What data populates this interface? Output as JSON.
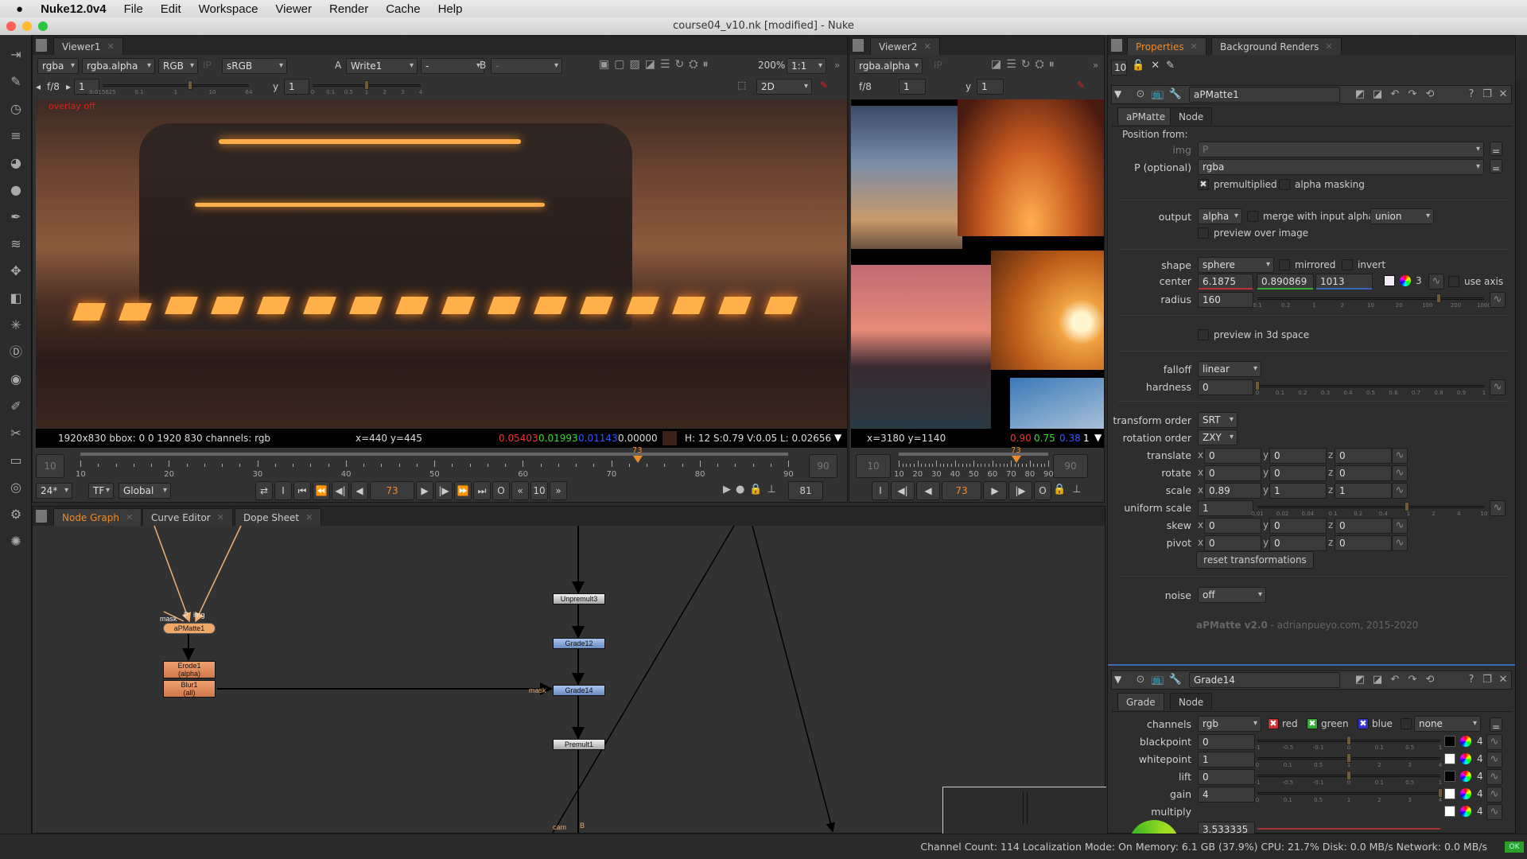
{
  "menubar": {
    "app": "Nuke12.0v4",
    "items": [
      "File",
      "Edit",
      "Workspace",
      "Viewer",
      "Render",
      "Cache",
      "Help"
    ]
  },
  "window": {
    "title": "course04_v10.nk [modified] - Nuke"
  },
  "colors": {
    "accent": "#f08a28",
    "node_orange": "#e8926a",
    "node_blue": "#7a9ccc",
    "node_grey": "#c8c8c8",
    "pixel_swatch": "#3a2218"
  },
  "viewer1": {
    "tab": "Viewer1",
    "toolbar": {
      "channels": "rgba",
      "layer": "rgba.alpha",
      "display": "RGB",
      "ip": "IP",
      "lut": "sRGB",
      "a_label": "A",
      "a_input": "Write1",
      "wipe": "-",
      "b_label": "B",
      "b_input": "-",
      "zoom": "200%",
      "ratio": "1:1"
    },
    "row2": {
      "fstop": "f/8",
      "gain": "1",
      "gain_ticks": [
        "0.015625",
        "0.1",
        "1",
        "10",
        "64"
      ],
      "gamma_label": "y",
      "gamma": "1",
      "gamma_ticks": [
        "0",
        "0.1",
        "0.5",
        "1",
        "2",
        "3",
        "4"
      ],
      "mode": "2D"
    },
    "overlay": "overlay off",
    "info": {
      "format": "1920x830  bbox: 0 0 1920 830 channels: rgb",
      "coords": "x=440 y=445",
      "r": "0.05403",
      "g": "0.01993",
      "b": "0.01143",
      "a": "0.00000",
      "hsvl": "H: 12 S:0.79 V:0.05  L: 0.02656"
    },
    "timeline": {
      "start": "10",
      "end": "90",
      "ticks": [
        "10",
        "20",
        "30",
        "40",
        "50",
        "60",
        "70",
        "80",
        "90"
      ],
      "current": "73",
      "range": [
        10,
        90
      ]
    },
    "controls": {
      "fps": "24*",
      "tf": "TF",
      "scope": "Global",
      "in": "I",
      "out": "O",
      "frame": "73",
      "step": "10",
      "end_frame": "81"
    }
  },
  "viewer2": {
    "tab": "Viewer2",
    "toolbar": {
      "layer": "rgba.alpha",
      "ip": "IP"
    },
    "row2": {
      "fstop": "f/8",
      "gain": "1",
      "gamma_label": "y",
      "gamma": "1"
    },
    "info": {
      "coords": "x=3180 y=1140",
      "r": "0.90",
      "g": "0.75",
      "b": "0.38",
      "a": "1"
    },
    "timeline": {
      "start": "10",
      "end": "90",
      "ticks": [
        "10",
        "20",
        "30",
        "40",
        "50",
        "60",
        "70",
        "80",
        "90"
      ],
      "current": "73"
    },
    "controls": {
      "in": "I",
      "out": "O",
      "frame": "73"
    }
  },
  "nodegraph": {
    "tabs": [
      "Node Graph",
      "Curve Editor",
      "Dope Sheet"
    ],
    "nodes": {
      "apmatte": "aPMatte1",
      "erode": "Erode1\n(alpha)",
      "blur": "Blur1\n(all)",
      "unpremult": "Unpremult3",
      "grade12": "Grade12",
      "grade14": "Grade14",
      "premult": "Premult1"
    },
    "labels": {
      "mask": "mask",
      "p": "P",
      "img": "img",
      "mask2": "mask",
      "cam": "cam",
      "b": "B"
    }
  },
  "properties": {
    "tabs": [
      "Properties",
      "Background Renders"
    ],
    "max_panels": "10",
    "apmatte": {
      "name": "aPMatte1",
      "tabs": [
        "aPMatte",
        "Node"
      ],
      "position_from": "Position from:",
      "img_label": "img",
      "img_value": "P",
      "p_label": "P (optional)",
      "p_value": "rgba",
      "premultiplied": "premultiplied",
      "alpha_masking": "alpha masking",
      "output_label": "output",
      "output_value": "alpha",
      "merge_label": "merge with input alpha",
      "merge_op": "union",
      "preview_over": "preview over image",
      "shape_label": "shape",
      "shape_value": "sphere",
      "mirrored": "mirrored",
      "invert": "invert",
      "center_label": "center",
      "center": [
        "6.1875",
        "0.890869",
        "1013"
      ],
      "center_channels": "3",
      "use_axis": "use axis",
      "radius_label": "radius",
      "radius": "160",
      "radius_ticks": [
        "0.1",
        "0.2",
        "1",
        "2",
        "10",
        "20",
        "100",
        "200",
        "1000"
      ],
      "preview_3d": "preview in 3d space",
      "falloff_label": "falloff",
      "falloff_value": "linear",
      "hardness_label": "hardness",
      "hardness": "0",
      "hardness_ticks": [
        "0",
        "0.1",
        "0.2",
        "0.3",
        "0.4",
        "0.5",
        "0.6",
        "0.7",
        "0.8",
        "0.9",
        "1"
      ],
      "transform_order_label": "transform order",
      "transform_order": "SRT",
      "rotation_order_label": "rotation order",
      "rotation_order": "ZXY",
      "xyz": [
        {
          "label": "translate",
          "x": "0",
          "y": "0",
          "z": "0"
        },
        {
          "label": "rotate",
          "x": "0",
          "y": "0",
          "z": "0"
        },
        {
          "label": "scale",
          "x": "0.89",
          "y": "1",
          "z": "1"
        },
        {
          "label": "skew",
          "x": "0",
          "y": "0",
          "z": "0"
        },
        {
          "label": "pivot",
          "x": "0",
          "y": "0",
          "z": "0"
        }
      ],
      "axis_labels": [
        "x",
        "y",
        "z"
      ],
      "uniform_scale_label": "uniform scale",
      "uniform_scale": "1",
      "uniform_ticks": [
        "0.01",
        "0.02",
        "0.04",
        "0.1",
        "0.2",
        "0.4",
        "1",
        "2",
        "4",
        "10"
      ],
      "reset": "reset transformations",
      "noise_label": "noise",
      "noise_value": "off",
      "credit_name": "aPMatte v2.0",
      "credit_rest": " - adrianpueyo.com, 2015-2020"
    },
    "grade": {
      "name": "Grade14",
      "tabs": [
        "Grade",
        "Node"
      ],
      "channels_label": "channels",
      "channels": "rgb",
      "red": "red",
      "green": "green",
      "blue": "blue",
      "mask_channel": "none",
      "rows": [
        {
          "label": "blackpoint",
          "value": "0",
          "ticks": [
            "-1",
            "-0.5",
            "-0.1",
            "0",
            "0.1",
            "0.5",
            "1"
          ],
          "level": 0.5,
          "swatch": "#000000",
          "n": "4"
        },
        {
          "label": "whitepoint",
          "value": "1",
          "ticks": [
            "0",
            "0.1",
            "0.5",
            "1",
            "2",
            "3",
            "4"
          ],
          "level": 0.5,
          "swatch": "#ffffff",
          "n": "4"
        },
        {
          "label": "lift",
          "value": "0",
          "ticks": [
            "-1",
            "-0.5",
            "-0.1",
            "0",
            "0.1",
            "0.5",
            "1"
          ],
          "level": 0.5,
          "swatch": "#000000",
          "n": "4"
        },
        {
          "label": "gain",
          "value": "4",
          "ticks": [
            "0",
            "0.1",
            "0.5",
            "1",
            "2",
            "3",
            "4"
          ],
          "level": 1.0,
          "swatch": "#ffffff",
          "n": "4"
        }
      ],
      "multiply_label": "multiply",
      "multiply_n": "4",
      "multiply_value": "3.533335"
    }
  },
  "status": {
    "text": "Channel Count: 114  Localization Mode: On  Memory: 6.1 GB (37.9%)  CPU: 21.7%  Disk: 0.0 MB/s  Network: 0.0 MB/s",
    "ok": "OK"
  }
}
